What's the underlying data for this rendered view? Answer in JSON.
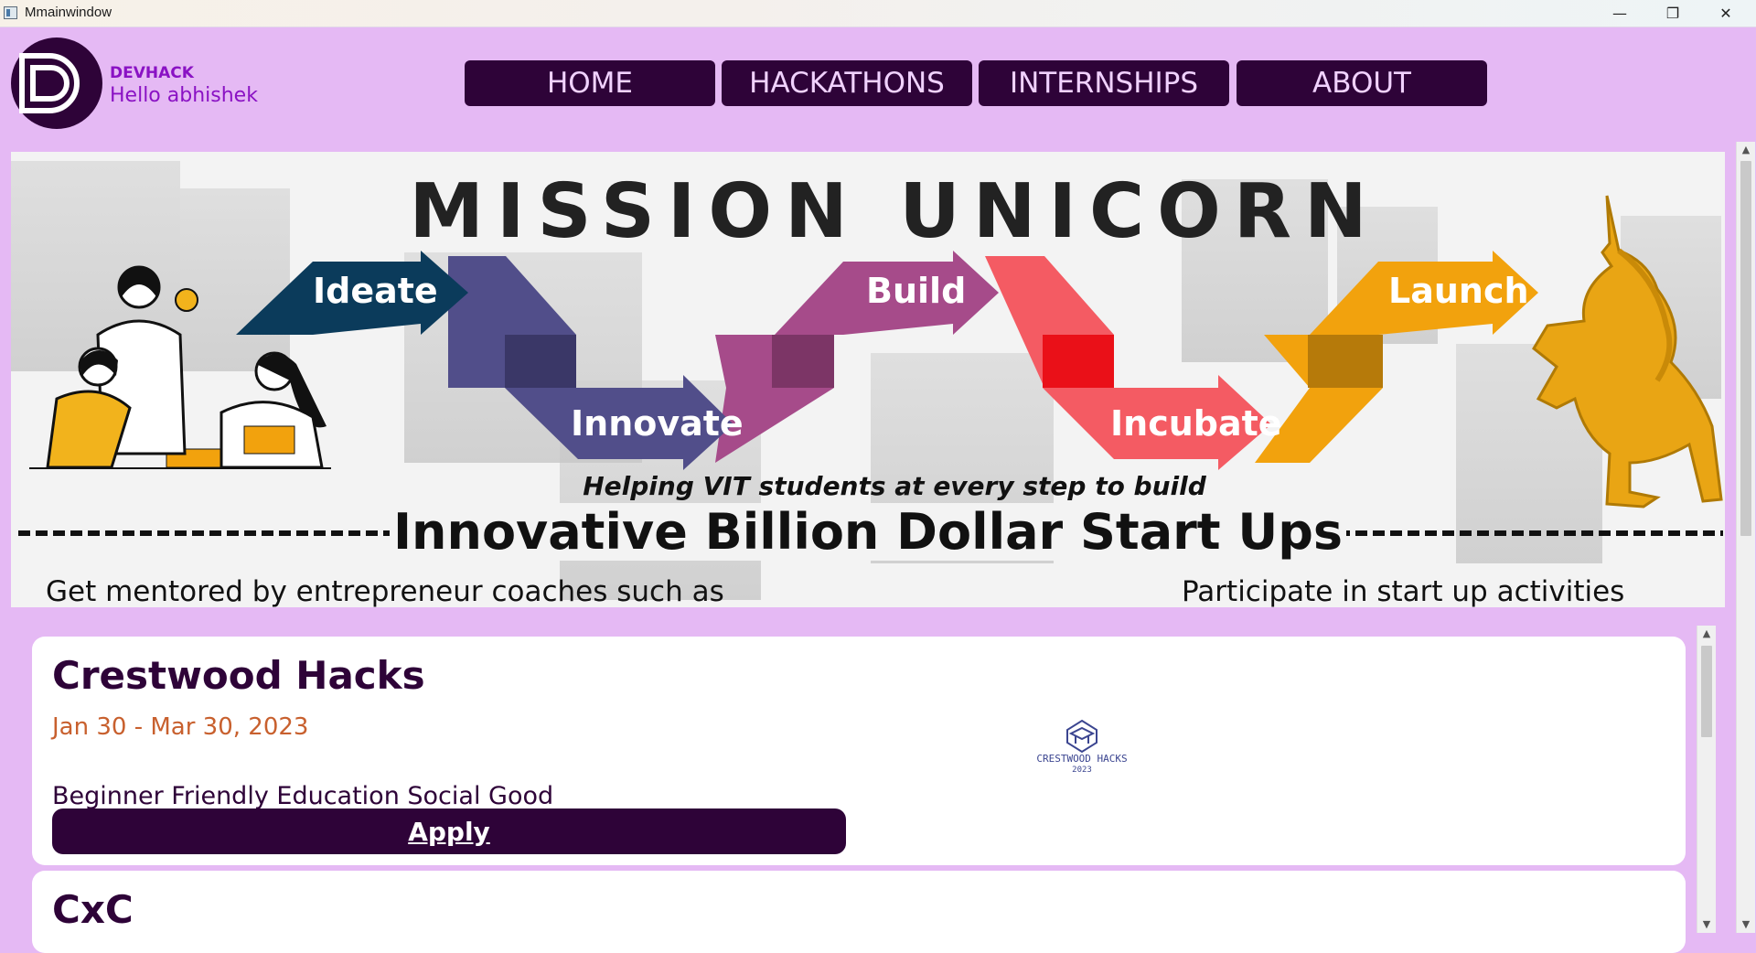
{
  "window": {
    "title": "Mmainwindow",
    "controls": {
      "minimize": "—",
      "restore": "❐",
      "close": "✕"
    }
  },
  "header": {
    "logo_icon": "devhack-logo-icon",
    "brand": "DEVHACK",
    "greeting": "Hello abhishek"
  },
  "nav": {
    "items": [
      {
        "label": "HOME"
      },
      {
        "label": "HACKATHONS"
      },
      {
        "label": "INTERNSHIPS"
      },
      {
        "label": "ABOUT"
      }
    ]
  },
  "banner": {
    "headline": "MISSION UNICORN",
    "steps": [
      "Ideate",
      "Innovate",
      "Build",
      "Incubate",
      "Launch"
    ],
    "step_colors": [
      "#0b3b5b",
      "#514e8a",
      "#a64b8a",
      "#f45b63",
      "#f2a20d"
    ],
    "subline": "Helping VIT students at every step to build",
    "main_line": "Innovative Billion Dollar Start Ups",
    "left_caption": "Get mentored by entrepreneur coaches such as",
    "right_caption": "Participate in start up activities"
  },
  "hackathons": [
    {
      "name": "Crestwood Hacks",
      "dates": "Jan 30 - Mar 30, 2023",
      "tags": "Beginner Friendly Education Social Good",
      "apply_label": "Apply",
      "logo_text_line1": "CRESTWOOD HACKS",
      "logo_text_line2": "2023"
    },
    {
      "name": "CxC"
    }
  ],
  "colors": {
    "background": "#e5b9f4",
    "nav_bg": "#2e0338",
    "nav_text": "#f1d2ff",
    "accent_purple": "#8a12c4",
    "date_orange": "#c8602e"
  }
}
